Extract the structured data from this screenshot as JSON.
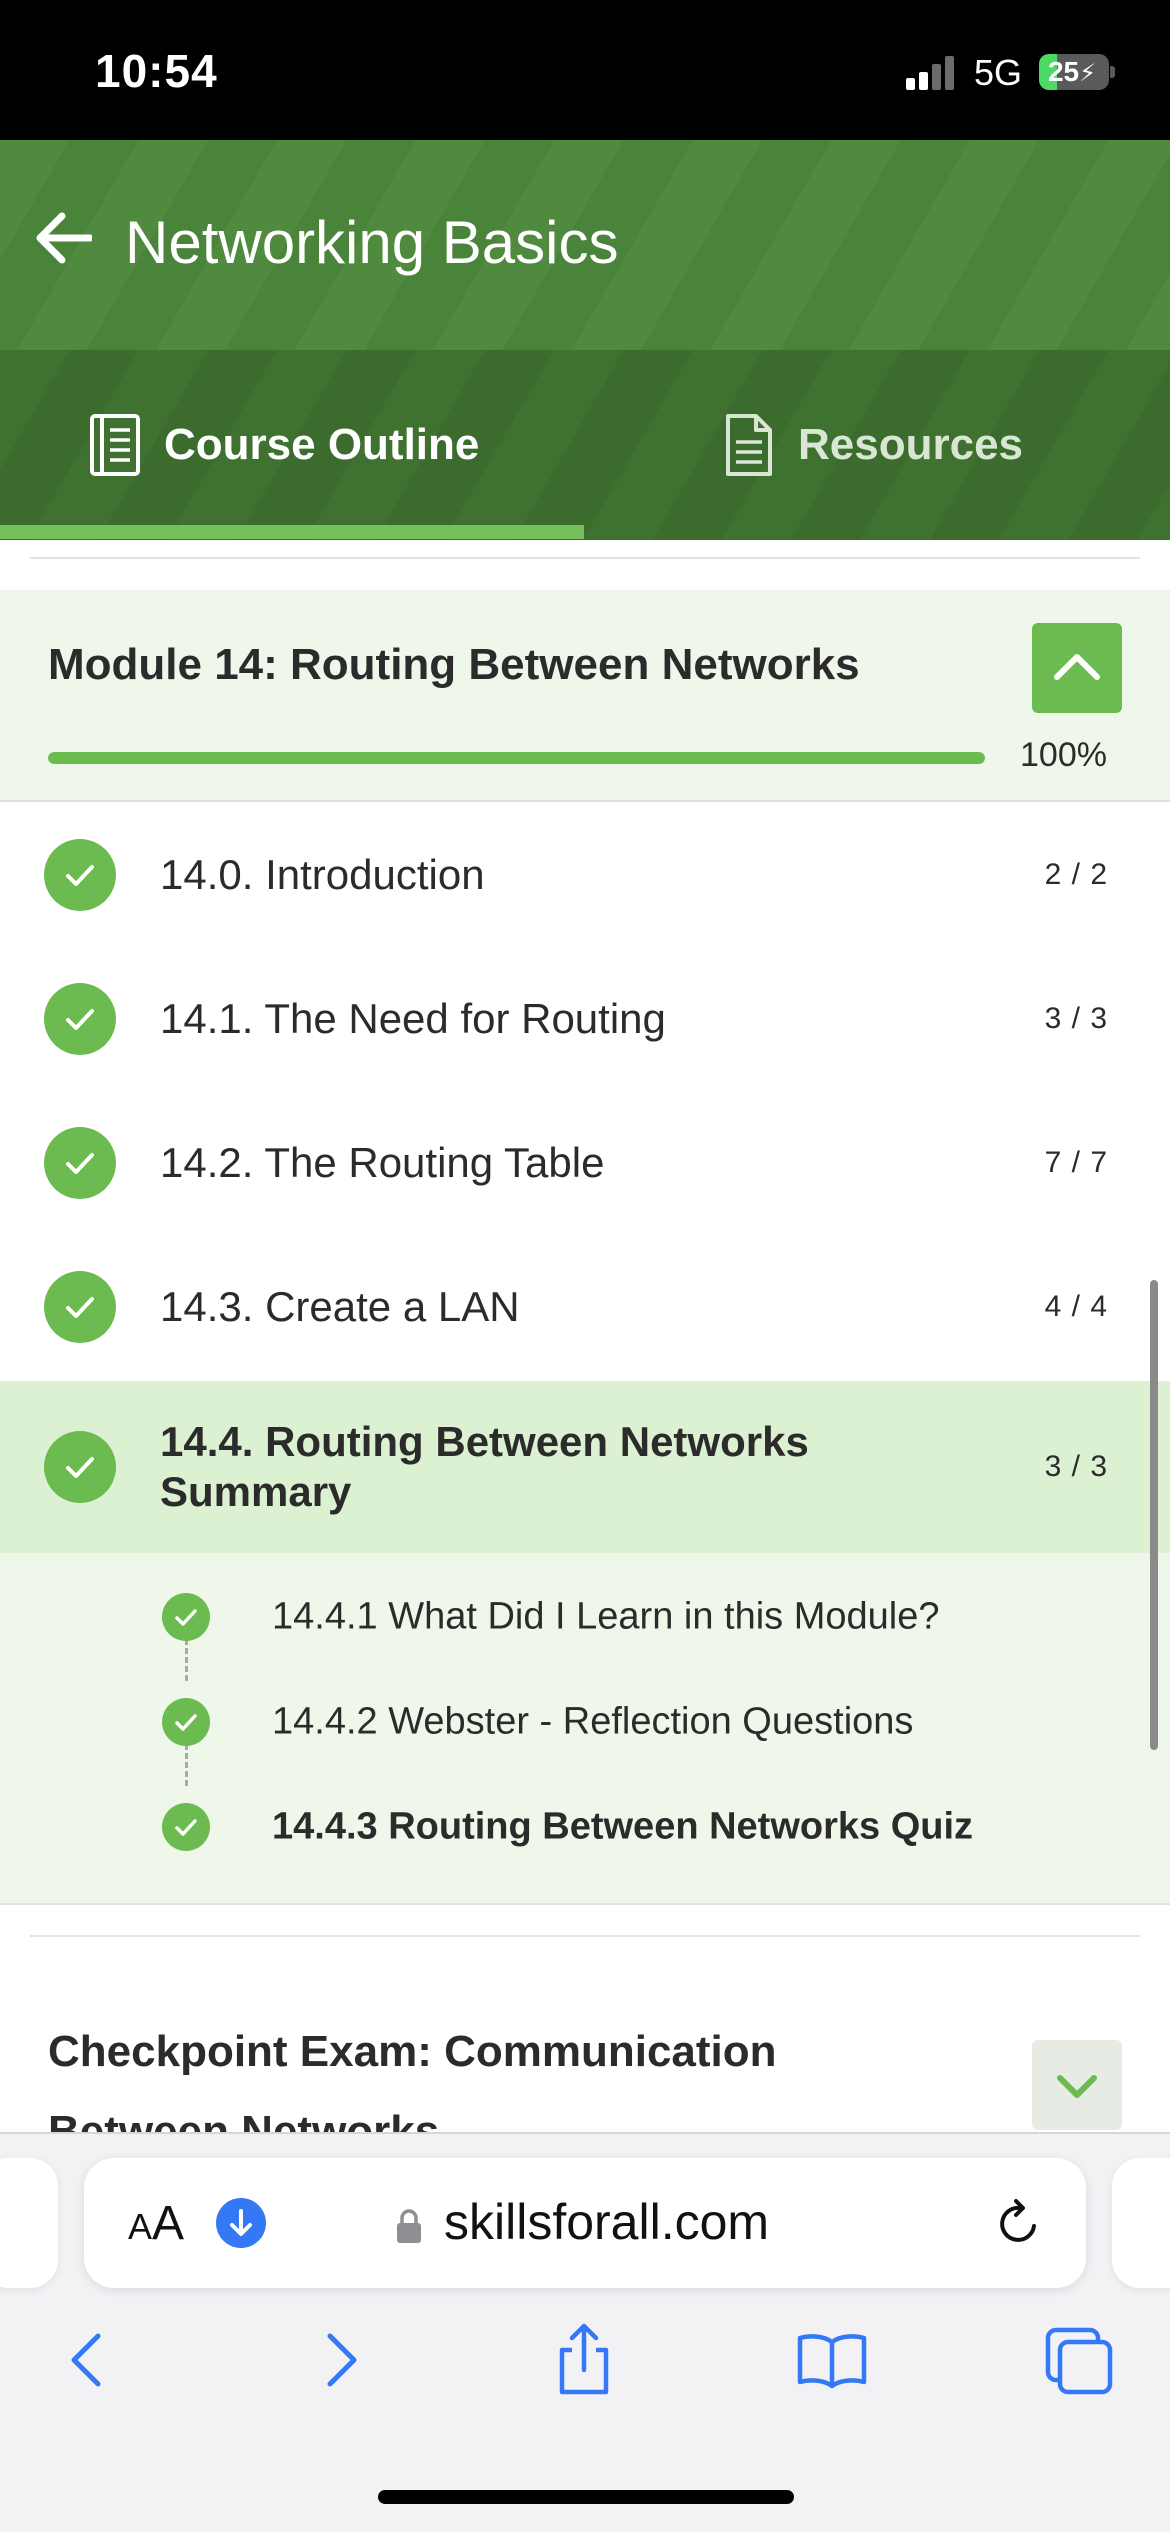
{
  "status_bar": {
    "time": "10:54",
    "network": "5G",
    "battery": "25",
    "battery_level_percent": 25
  },
  "header": {
    "title": "Networking Basics"
  },
  "tabs": [
    {
      "label": "Course Outline",
      "icon": "book-outline-icon",
      "active": true
    },
    {
      "label": "Resources",
      "icon": "document-icon",
      "active": false
    }
  ],
  "module": {
    "title": "Module 14: Routing Between Networks",
    "progress_text": "100%",
    "progress_percent": 100,
    "expanded": true,
    "sections": [
      {
        "label": "14.0. Introduction",
        "count": "2 / 2"
      },
      {
        "label": "14.1. The Need for Routing",
        "count": "3 / 3"
      },
      {
        "label": "14.2. The Routing Table",
        "count": "7 / 7"
      },
      {
        "label": "14.3. Create a LAN",
        "count": "4 / 4"
      }
    ],
    "active_section": {
      "label": "14.4. Routing Between Networks Summary",
      "count": "3 / 3"
    },
    "subsections": [
      {
        "label": "14.4.1 What Did I Learn in this Module?"
      },
      {
        "label": "14.4.2 Webster - Reflection Questions"
      },
      {
        "label": "14.4.3 Routing Between Networks Quiz"
      }
    ]
  },
  "next_module": {
    "title": "Checkpoint Exam: Communication Between Networks"
  },
  "browser": {
    "aa_label_small": "A",
    "aa_label_large": "A",
    "url": "skillsforall.com"
  },
  "colors": {
    "brand_green": "#4f8a3f",
    "accent_green": "#6cbb50",
    "active_row": "#dcf0d2",
    "ios_blue": "#3478f6"
  }
}
